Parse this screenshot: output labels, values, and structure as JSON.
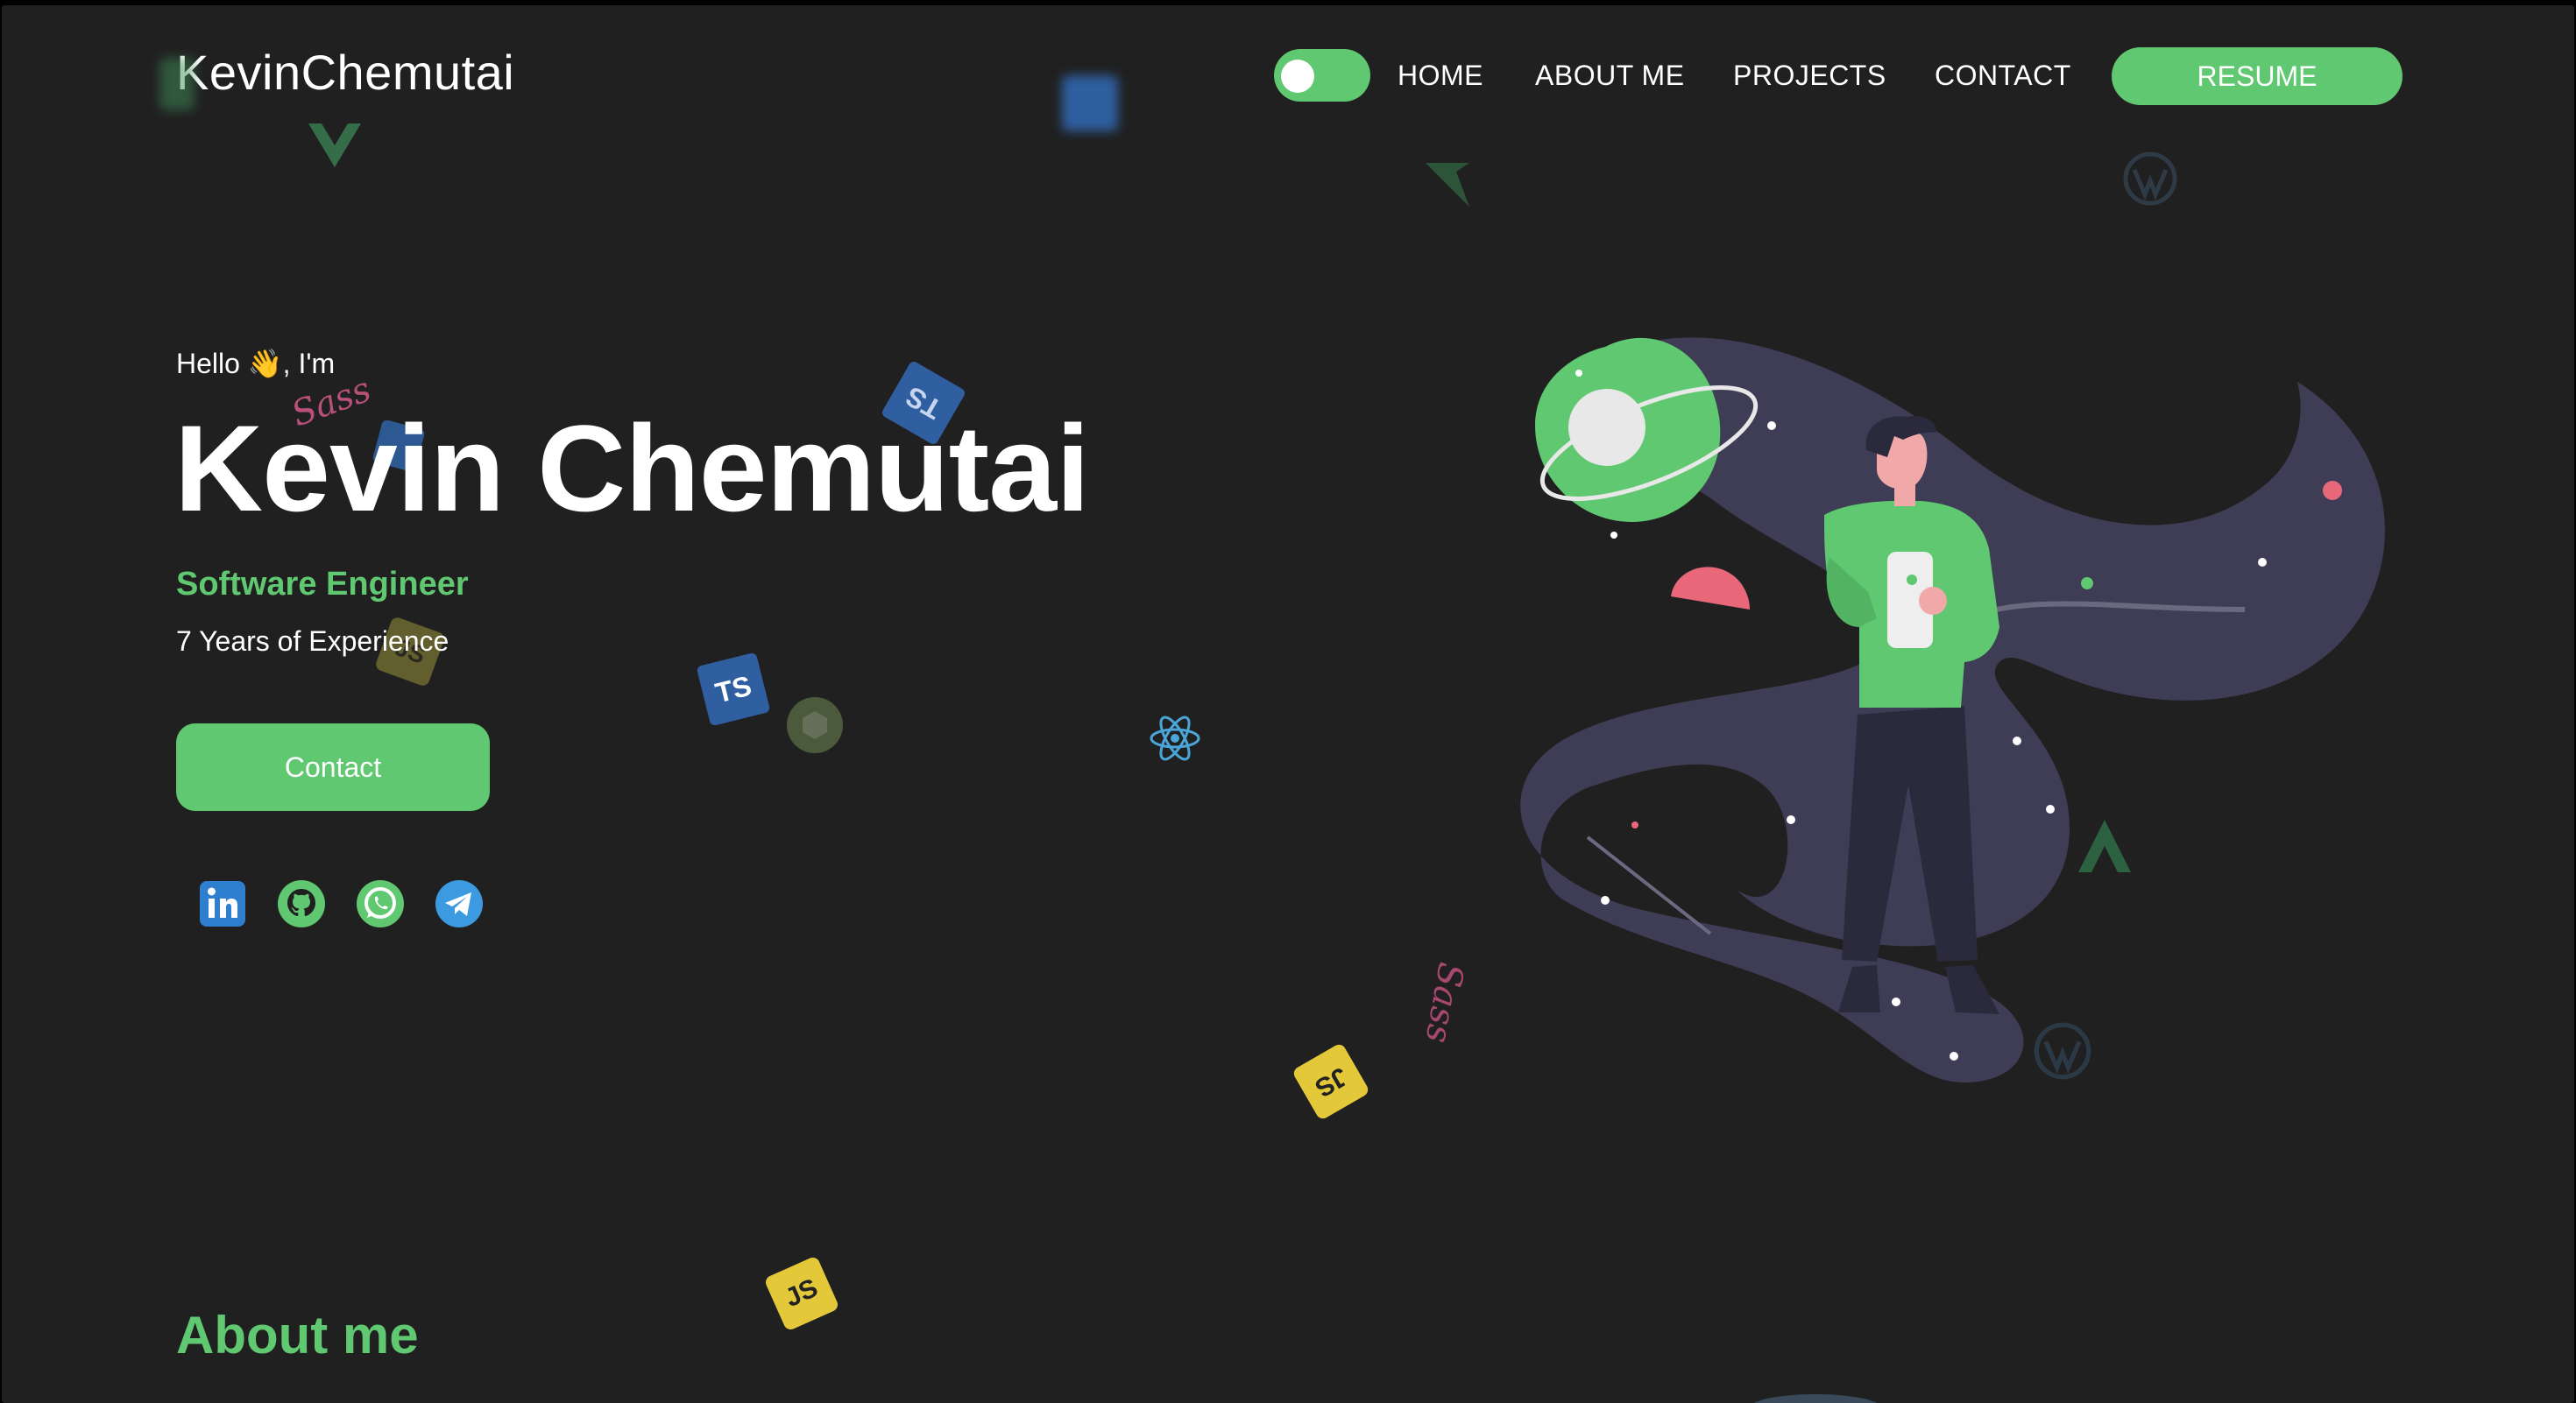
{
  "header": {
    "logo": "KevinChemutai",
    "theme_toggle": {
      "state": "on"
    },
    "nav": [
      {
        "label": "HOME"
      },
      {
        "label": "ABOUT ME"
      },
      {
        "label": "PROJECTS"
      },
      {
        "label": "CONTACT"
      }
    ],
    "resume_label": "RESUME"
  },
  "hero": {
    "greeting_before": "Hello",
    "greeting_emoji": "👋",
    "greeting_after": ", I'm",
    "name": "Kevin Chemutai",
    "role": "Software Engineer",
    "experience": "7 Years of Experience",
    "contact_label": "Contact"
  },
  "socials": [
    {
      "icon": "linkedin-icon",
      "color": "#2f7fd0"
    },
    {
      "icon": "github-icon",
      "color": "#5fc870"
    },
    {
      "icon": "whatsapp-icon",
      "color": "#5fc870"
    },
    {
      "icon": "telegram-icon",
      "color": "#3c9be0"
    }
  ],
  "about": {
    "heading": "About me"
  },
  "floating_icons": {
    "ts_badge": "TS",
    "js_badge": "JS",
    "sass_script": "Sass"
  },
  "colors": {
    "accent": "#5fc870",
    "background": "#202020",
    "ts_blue": "#2f5fa0",
    "js_yellow": "#e3c83a",
    "sass_pink": "#b8507a"
  }
}
